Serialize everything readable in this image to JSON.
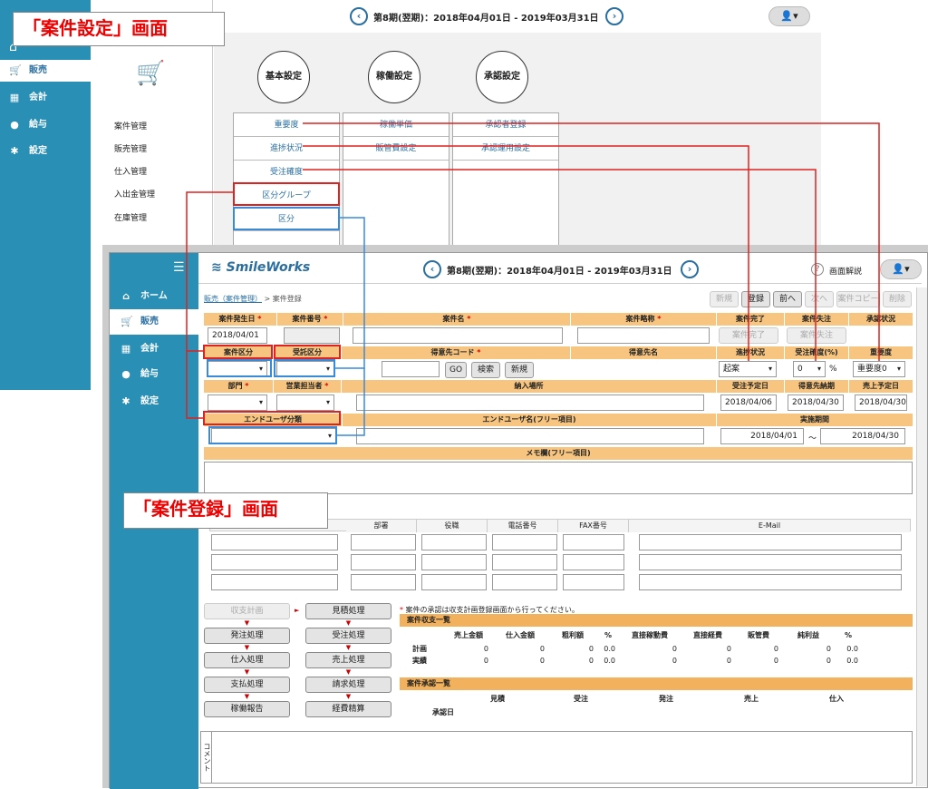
{
  "callouts": {
    "top": "「案件設定」画面",
    "bottom": "「案件登録」画面"
  },
  "back": {
    "period": "第8期(翌期)：2018年04月01日 - 2019年03月31日",
    "nav": [
      {
        "label": "販売",
        "icon": "cart-icon"
      },
      {
        "label": "会計",
        "icon": "calculator-icon"
      },
      {
        "label": "給与",
        "icon": "money-bag-icon"
      },
      {
        "label": "設定",
        "icon": "gear-icon"
      }
    ],
    "sub_menu": [
      "案件管理",
      "販売管理",
      "仕入管理",
      "入出金管理",
      "在庫管理"
    ],
    "circles": [
      "基本設定",
      "稼働設定",
      "承認設定"
    ],
    "col1": [
      "重要度",
      "進捗状況",
      "受注確度",
      "区分グループ",
      "区分"
    ],
    "col2": [
      "稼働単価",
      "販管費設定"
    ],
    "col3": [
      "承認者登録",
      "承認運用設定"
    ]
  },
  "front": {
    "logo": "SmileWorks",
    "period": "第8期(翌期)：2018年04月01日 - 2019年03月31日",
    "help": "画面解説",
    "nav": [
      {
        "label": "ホーム",
        "icon": "home-icon"
      },
      {
        "label": "販売",
        "icon": "cart-icon"
      },
      {
        "label": "会計",
        "icon": "calculator-icon"
      },
      {
        "label": "給与",
        "icon": "money-bag-icon"
      },
      {
        "label": "設定",
        "icon": "gear-icon"
      }
    ],
    "breadcrumb_link": "販売（案件管理）",
    "breadcrumb_sep": " > ",
    "breadcrumb_current": "案件登録",
    "toolbar": [
      "新規",
      "登録",
      "前へ",
      "次へ",
      "案件コピー",
      "削除"
    ],
    "row1": {
      "h_date": "案件発生日",
      "h_no": "案件番号",
      "h_name": "案件名",
      "h_short": "案件略称",
      "h_done": "案件完了",
      "h_order": "案件失注",
      "h_approve": "承認状況",
      "date": "2018/04/01",
      "btn_done": "案件完了",
      "btn_order": "案件失注"
    },
    "row2": {
      "h_kbn": "案件区分",
      "h_jkbn": "受託区分",
      "h_code": "得意先コード",
      "h_cname": "得意先名",
      "h_prog": "進捗状況",
      "h_prob": "受注確度(%)",
      "h_imp": "重要度",
      "go": "GO",
      "search": "検索",
      "new": "新規",
      "prog": "起案",
      "prob": "0",
      "pct": "%",
      "imp": "重要度0"
    },
    "row3": {
      "h_dept": "部門",
      "h_staff": "営業担当者",
      "h_place": "納入場所",
      "h_odate": "受注予定日",
      "h_ddate": "得意先納期",
      "h_sdate": "売上予定日",
      "odate": "2018/04/06",
      "ddate": "2018/04/30",
      "sdate": "2018/04/30"
    },
    "row4": {
      "h_enduser": "エンドユーザ分類",
      "h_endname": "エンドユーザ名(フリー項目)",
      "h_period": "実施期間",
      "from": "2018/04/01",
      "tilde": "～",
      "to": "2018/04/30"
    },
    "memo": "メモ欄(フリー項目)",
    "contact_headers": [
      "部署",
      "役職",
      "電話番号",
      "FAX番号",
      "E-Mail"
    ],
    "flow_left": [
      "収支計画",
      "発注処理",
      "仕入処理",
      "支払処理",
      "稼働報告"
    ],
    "flow_right": [
      "見積処理",
      "受注処理",
      "売上処理",
      "請求処理",
      "経費精算"
    ],
    "note_mark": "*",
    "note": "案件の承認は収支計画登録画面から行ってください。",
    "summary": {
      "title": "案件収支一覧",
      "headers": [
        "売上金額",
        "仕入金額",
        "粗利額",
        "%",
        "直接稼動費",
        "直接経費",
        "販管費",
        "純利益",
        "%"
      ],
      "rows": [
        {
          "label": "計画",
          "values": [
            "0",
            "0",
            "0",
            "0.0",
            "0",
            "0",
            "0",
            "0",
            "0.0"
          ]
        },
        {
          "label": "実績",
          "values": [
            "0",
            "0",
            "0",
            "0.0",
            "0",
            "0",
            "0",
            "0",
            "0.0"
          ]
        }
      ]
    },
    "approval": {
      "title": "案件承認一覧",
      "headers": [
        "見積",
        "受注",
        "発注",
        "売上",
        "仕入"
      ],
      "row_label": "承認日"
    },
    "comment": "コメント"
  }
}
